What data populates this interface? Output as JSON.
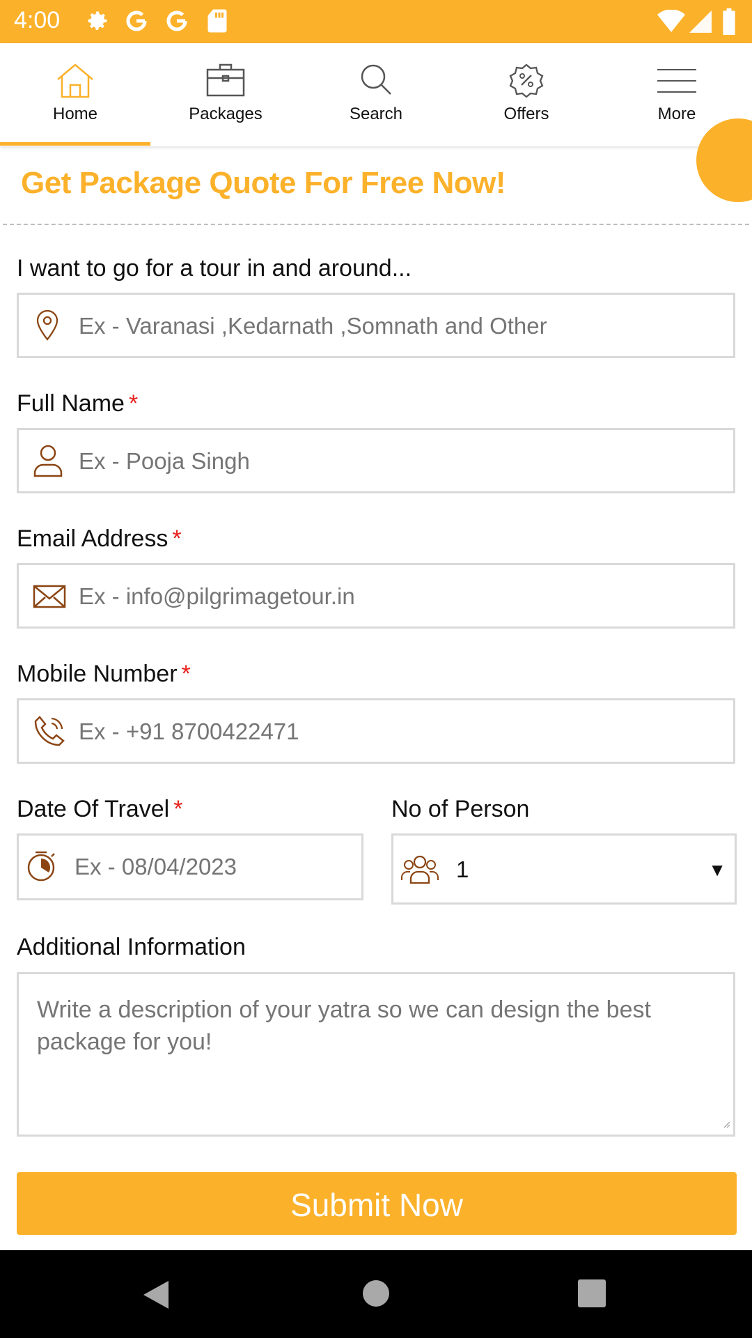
{
  "status_bar": {
    "time": "4:00"
  },
  "nav": {
    "items": [
      {
        "label": "Home",
        "icon": "home-icon",
        "active": true
      },
      {
        "label": "Packages",
        "icon": "briefcase-icon"
      },
      {
        "label": "Search",
        "icon": "search-icon"
      },
      {
        "label": "Offers",
        "icon": "offer-badge-icon"
      },
      {
        "label": "More",
        "icon": "menu-icon"
      }
    ]
  },
  "form": {
    "title": "Get Package Quote For Free Now!",
    "destination": {
      "label": "I want to go for a tour in and around...",
      "placeholder": "Ex - Varanasi ,Kedarnath ,Somnath and Other"
    },
    "full_name": {
      "label": "Full Name",
      "required": "*",
      "placeholder": "Ex - Pooja Singh"
    },
    "email": {
      "label": "Email Address",
      "required": "*",
      "placeholder": "Ex - info@pilgrimagetour.in"
    },
    "mobile": {
      "label": "Mobile Number",
      "required": "*",
      "placeholder": "Ex - +91 8700422471"
    },
    "date": {
      "label": "Date Of Travel",
      "required": "*",
      "placeholder": "Ex - 08/04/2023"
    },
    "persons": {
      "label": "No of Person",
      "value": "1"
    },
    "additional": {
      "label": "Additional Information",
      "placeholder": "Write a description of your yatra so we can design the best package for you!"
    },
    "submit_label": "Submit Now"
  },
  "colors": {
    "accent": "#fbb12a",
    "icon_brown": "#8b4513",
    "required": "#e8201b"
  }
}
